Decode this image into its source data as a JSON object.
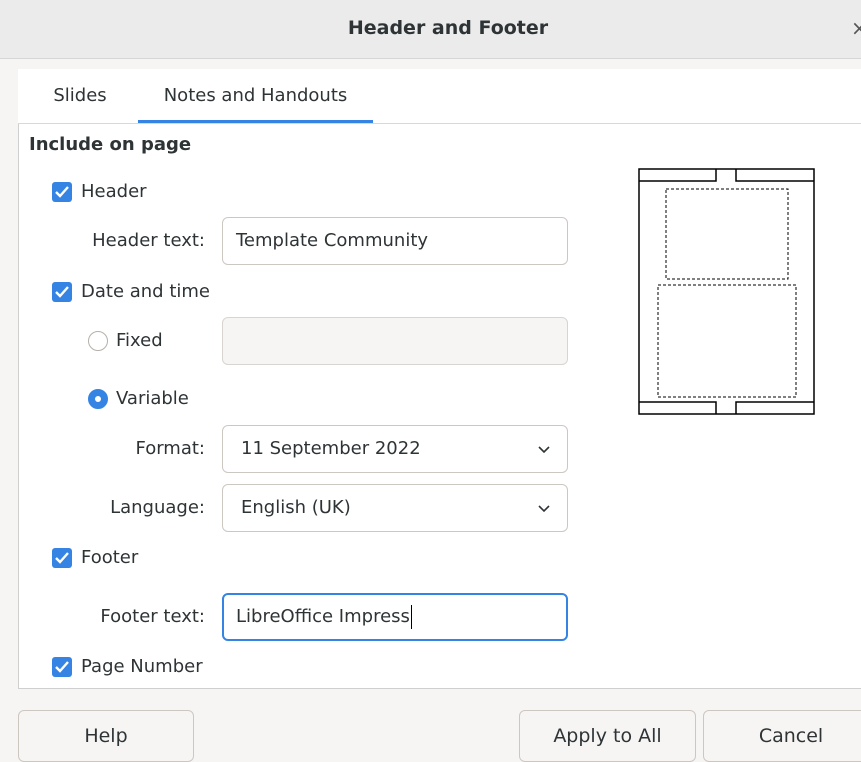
{
  "window": {
    "title": "Header and Footer",
    "close_glyph": "×"
  },
  "tabs": [
    {
      "label": "Slides",
      "active": false
    },
    {
      "label": "Notes and Handouts",
      "active": true
    }
  ],
  "section": {
    "title": "Include on page"
  },
  "header": {
    "checkbox_label": "Header",
    "checked": true,
    "text_label": "Header text:",
    "text_value": "Template Community"
  },
  "datetime": {
    "checkbox_label": "Date and time",
    "checked": true,
    "fixed_label": "Fixed",
    "fixed_value": "",
    "variable_label": "Variable",
    "selected": "Variable",
    "format_label": "Format:",
    "format_value": "11 September 2022",
    "language_label": "Language:",
    "language_value": "English (UK)"
  },
  "footer": {
    "checkbox_label": "Footer",
    "checked": true,
    "text_label": "Footer text:",
    "text_value": "LibreOffice Impress"
  },
  "page_number": {
    "checkbox_label": "Page Number",
    "checked": true
  },
  "buttons": {
    "help": "Help",
    "apply_all": "Apply to All",
    "cancel": "Cancel"
  },
  "colors": {
    "accent": "#3584e4",
    "background": "#f6f5f4"
  },
  "icons": [
    "close-icon",
    "checkmark-icon",
    "chevron-down-icon",
    "page-layout-preview"
  ]
}
